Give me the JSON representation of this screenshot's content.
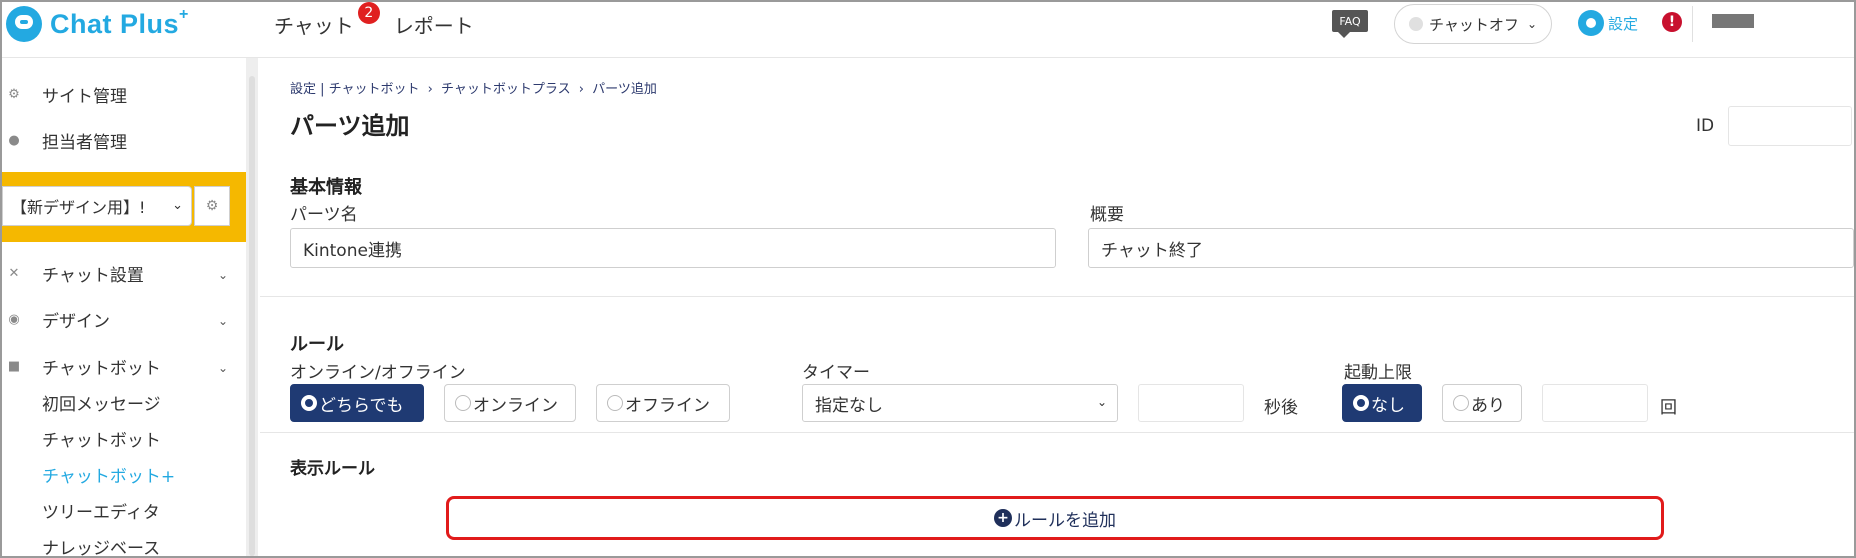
{
  "app": {
    "brand": "Chat Plus",
    "brand_sup": "+",
    "colors": {
      "brand": "#23a9e1",
      "navy": "#1f3a73",
      "highlight": "#f5b800",
      "alert": "#e11b1b"
    }
  },
  "header": {
    "nav": [
      {
        "label": "チャット",
        "badge": "2"
      },
      {
        "label": "レポート"
      }
    ],
    "faq": "FAQ",
    "status": "チャットオフ",
    "settings": "設定",
    "alert": "!"
  },
  "sidebar": {
    "items_top": [
      {
        "label": "サイト管理",
        "icon": "gear-icon"
      },
      {
        "label": "担当者管理",
        "icon": "users-icon"
      }
    ],
    "site_select": "【新デザイン用】!",
    "sections": [
      {
        "label": "チャット設置",
        "icon": "tools-icon"
      },
      {
        "label": "デザイン",
        "icon": "palette-icon"
      },
      {
        "label": "チャットボット",
        "icon": "chat-bubbles-icon"
      }
    ],
    "sub_items": [
      {
        "label": "初回メッセージ"
      },
      {
        "label": "チャットボット"
      },
      {
        "label": "チャットボット+",
        "active": true
      },
      {
        "label": "ツリーエディタ"
      },
      {
        "label": "ナレッジベース"
      }
    ]
  },
  "main": {
    "breadcrumb": [
      "設定 | チャットボット",
      "›",
      "チャットボットプラス",
      "›",
      "パーツ追加"
    ],
    "title": "パーツ追加",
    "id_label": "ID",
    "id_value": "",
    "basic": {
      "title": "基本情報",
      "name_label": "パーツ名",
      "name_value": "Kintone連携",
      "summary_label": "概要",
      "summary_value": "チャット終了"
    },
    "rule": {
      "title": "ルール",
      "online_label": "オンライン/オフライン",
      "online_options": [
        "どちらでも",
        "オンライン",
        "オフライン"
      ],
      "online_selected": "どちらでも",
      "timer_label": "タイマー",
      "timer_value": "指定なし",
      "timer_unit": "秒後",
      "limit_label": "起動上限",
      "limit_options": [
        "なし",
        "あり"
      ],
      "limit_selected": "なし",
      "limit_unit": "回"
    },
    "display_rule": {
      "title": "表示ルール",
      "add_button": "ルールを追加"
    }
  }
}
